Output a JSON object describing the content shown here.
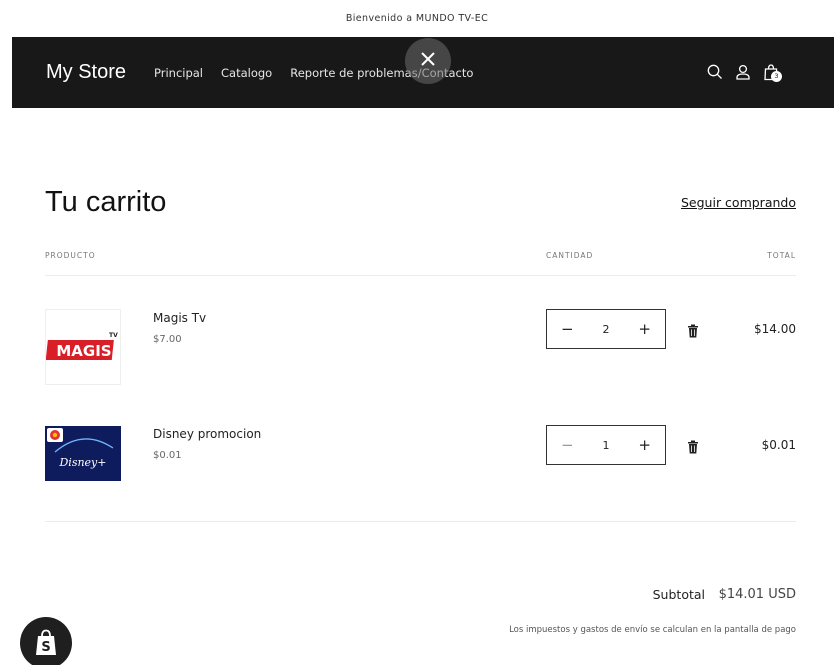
{
  "announcement": {
    "text": "Bienvenido a MUNDO TV-EC"
  },
  "header": {
    "logo": "My Store",
    "nav": [
      "Principal",
      "Catalogo",
      "Reporte de problemas/Contacto"
    ],
    "cart_count": "3",
    "icons": [
      "search-icon",
      "account-icon",
      "cart-icon"
    ]
  },
  "overlay": {
    "icon": "close-icon"
  },
  "cart": {
    "title": "Tu carrito",
    "continue_label": "Seguir comprando",
    "columns": {
      "product": "PRODUCTO",
      "quantity": "CANTIDAD",
      "total": "TOTAL"
    },
    "items": [
      {
        "name": "Magis Tv",
        "price": "$7.00",
        "quantity": "2",
        "total": "$14.00",
        "image_text": "MAGIS",
        "image_badge": "TV"
      },
      {
        "name": "Disney promocion",
        "price": "$0.01",
        "quantity": "1",
        "total": "$0.01",
        "image_text": "Disney+"
      }
    ],
    "qty_minus": "−",
    "qty_plus": "+",
    "subtotal_label": "Subtotal",
    "subtotal_value": "$14.01 USD",
    "tax_note": "Los impuestos y gastos de envío se calculan en la pantalla de pago"
  },
  "colors": {
    "header_bg": "#181818",
    "text": "#121212",
    "muted": "#777777",
    "magis_red": "#d81e26",
    "disney_blue": "#0e1b5c"
  },
  "shopify_badge": {
    "icon": "shopify-bag-icon",
    "letter": "S"
  }
}
